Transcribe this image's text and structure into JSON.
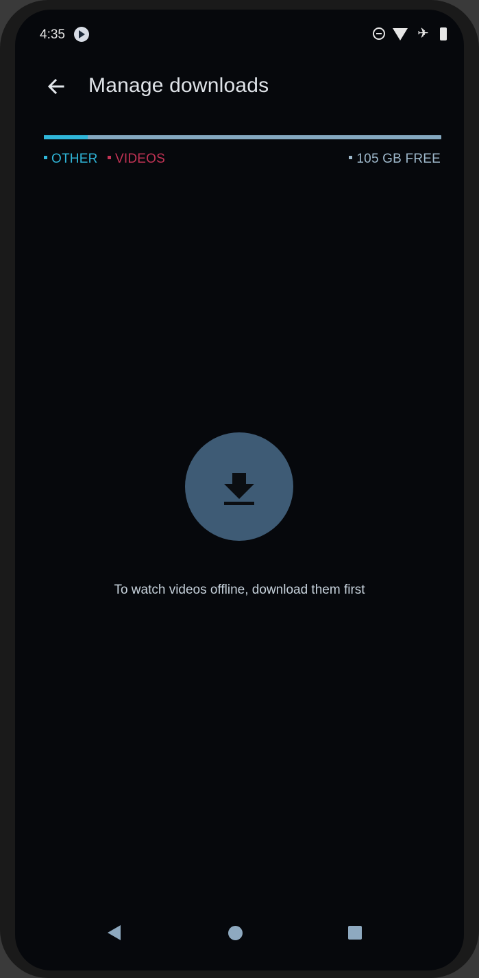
{
  "status_bar": {
    "time": "4:35",
    "icons": [
      "app-notification-icon",
      "do-not-disturb-icon",
      "wifi-icon",
      "airplane-icon",
      "battery-icon"
    ]
  },
  "app_bar": {
    "title": "Manage downloads",
    "back_icon": "arrow-back-icon"
  },
  "storage": {
    "other_fraction": 0.11,
    "videos_fraction": 0.0,
    "legend": {
      "other": "OTHER",
      "videos": "VIDEOS",
      "free": "105 GB FREE"
    },
    "colors": {
      "other": "#2fb6d9",
      "videos": "#c23355",
      "free": "#84a8c0"
    }
  },
  "empty_state": {
    "icon": "download-icon",
    "message": "To watch videos offline, download them first"
  },
  "nav_bar": {
    "back": "nav-back-icon",
    "home": "nav-home-icon",
    "recents": "nav-recents-icon"
  }
}
